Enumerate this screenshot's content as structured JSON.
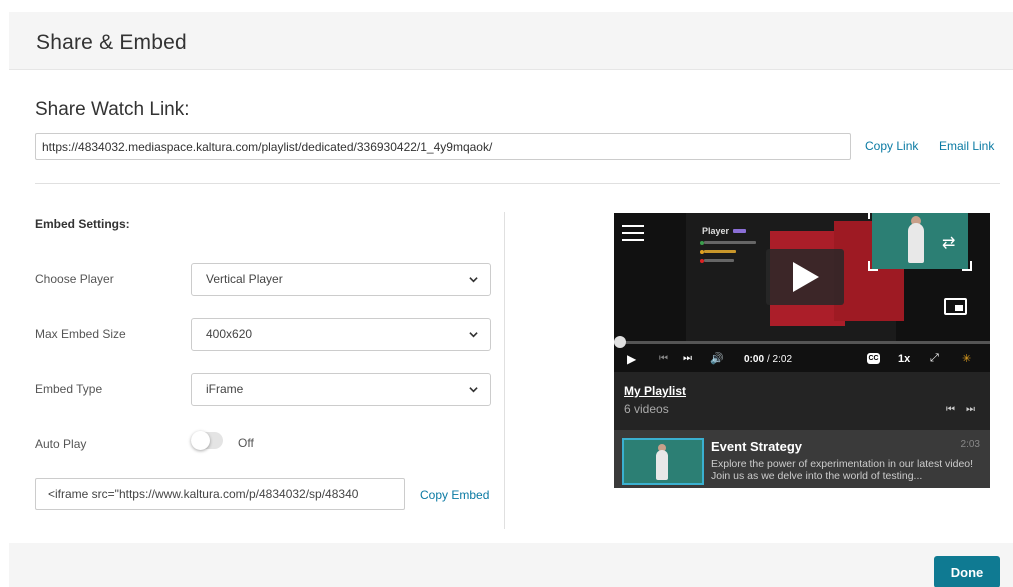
{
  "modal": {
    "title": "Share & Embed"
  },
  "share": {
    "heading": "Share Watch Link:",
    "url": "https://4834032.mediaspace.kaltura.com/playlist/dedicated/336930422/1_4y9mqaok/",
    "copy_link": "Copy Link",
    "email_link": "Email Link"
  },
  "embed": {
    "heading": "Embed Settings:",
    "choose_player": {
      "label": "Choose Player",
      "value": "Vertical Player"
    },
    "max_size": {
      "label": "Max Embed Size",
      "value": "400x620"
    },
    "embed_type": {
      "label": "Embed Type",
      "value": "iFrame"
    },
    "auto_play": {
      "label": "Auto Play",
      "state": "Off",
      "on": false
    },
    "code": "<iframe src=\"https://www.kaltura.com/p/4834032/sp/48340",
    "copy_embed": "Copy Embed"
  },
  "player": {
    "slide_title": "Player",
    "current_time": "0:00",
    "duration": "/ 2:02",
    "speed": "1x",
    "cc": "CC",
    "progress": 0,
    "playlist_title": "My Playlist",
    "playlist_count": "6 videos",
    "item": {
      "title": "Event Strategy",
      "duration": "2:03",
      "description": "Explore the power of experimentation in our latest video! Join us as we delve into the world of testing..."
    }
  },
  "footer": {
    "done": "Done"
  },
  "colors": {
    "accent": "#0f7a92",
    "link": "#0a7aa3"
  },
  "icons": [
    "menu-icon",
    "play-icon",
    "swap-icon",
    "pip-icon",
    "prev-icon",
    "next-icon",
    "volume-icon",
    "cc-icon",
    "fullscreen-icon",
    "kaltura-logo-icon",
    "chevron-down-icon"
  ]
}
